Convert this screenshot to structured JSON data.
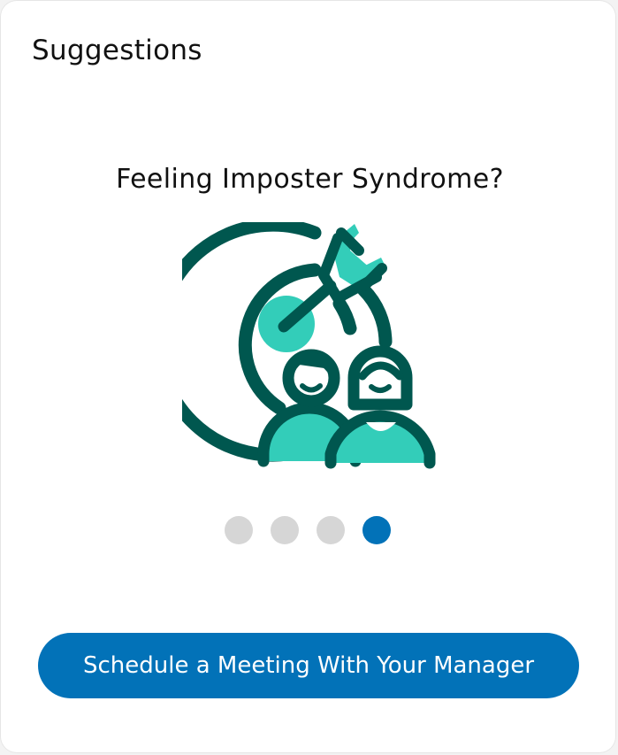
{
  "card": {
    "title": "Suggestions"
  },
  "suggestion": {
    "heading": "Feeling Imposter Syndrome?",
    "illustration_icon": "target-with-arrow-and-people-icon"
  },
  "carousel": {
    "total_slides": 4,
    "active_slide": 4,
    "dot_color": "#d6d6d6",
    "active_dot_color": "#0272b8"
  },
  "cta": {
    "label": "Schedule a Meeting With Your Manager"
  },
  "colors": {
    "primary_blue": "#0272b8",
    "icon_dark_teal": "#00574f",
    "icon_accent_teal": "#33cdb9"
  }
}
